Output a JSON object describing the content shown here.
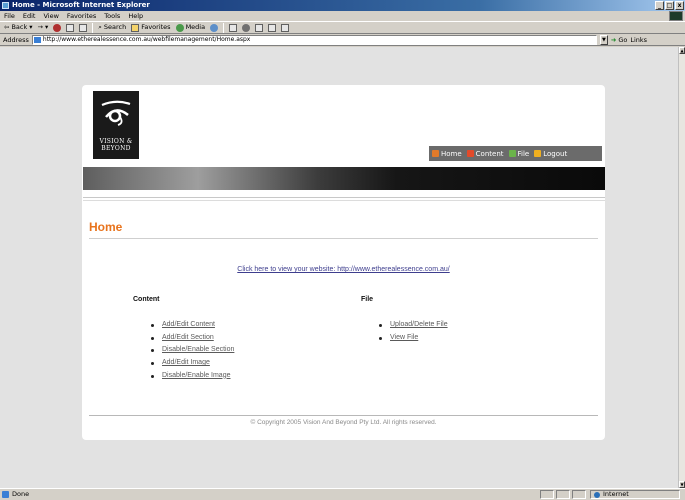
{
  "window": {
    "title": "Home - Microsoft Internet Explorer",
    "controls": [
      "_",
      "□",
      "x"
    ]
  },
  "menubar": {
    "items": [
      "File",
      "Edit",
      "View",
      "Favorites",
      "Tools",
      "Help"
    ]
  },
  "toolbar": {
    "back": "Back",
    "search": "Search",
    "favorites": "Favorites",
    "media": "Media"
  },
  "addressbar": {
    "label": "Address",
    "url": "http://www.etherealessence.com.au/webfilemanagement/Home.aspx",
    "go": "Go",
    "links": "Links"
  },
  "site": {
    "logo": {
      "line1": "VISION &",
      "line2": "BEYOND",
      "colors": {
        "background": "#1a1a1a",
        "mark": "#ffffff"
      }
    },
    "nav": [
      {
        "label": "Home",
        "icon": "home-icon",
        "color": "#e07a2a"
      },
      {
        "label": "Content",
        "icon": "content-icon",
        "color": "#e24a2a"
      },
      {
        "label": "File",
        "icon": "file-icon",
        "color": "#6bb34a"
      },
      {
        "label": "Logout",
        "icon": "logout-icon",
        "color": "#f0b020"
      }
    ],
    "page_title": "Home",
    "site_link": "Click here to view your website: http://www.etherealessence.com.au/",
    "content_section": {
      "heading": "Content",
      "links": [
        "Add/Edit Content",
        "Add/Edit Section",
        "Disable/Enable Section",
        "Add/Edit Image",
        "Disable/Enable Image"
      ]
    },
    "file_section": {
      "heading": "File",
      "links": [
        "Upload/Delete File",
        "View File"
      ]
    },
    "copyright": "© Copyright 2005 Vision And Beyond Pty Ltd. All rights reserved.",
    "colors": {
      "accent": "#e8731c",
      "link": "#3e3e8e",
      "nav_bg": "#6b6b6b"
    }
  },
  "statusbar": {
    "text": "Done",
    "zone": "Internet"
  }
}
